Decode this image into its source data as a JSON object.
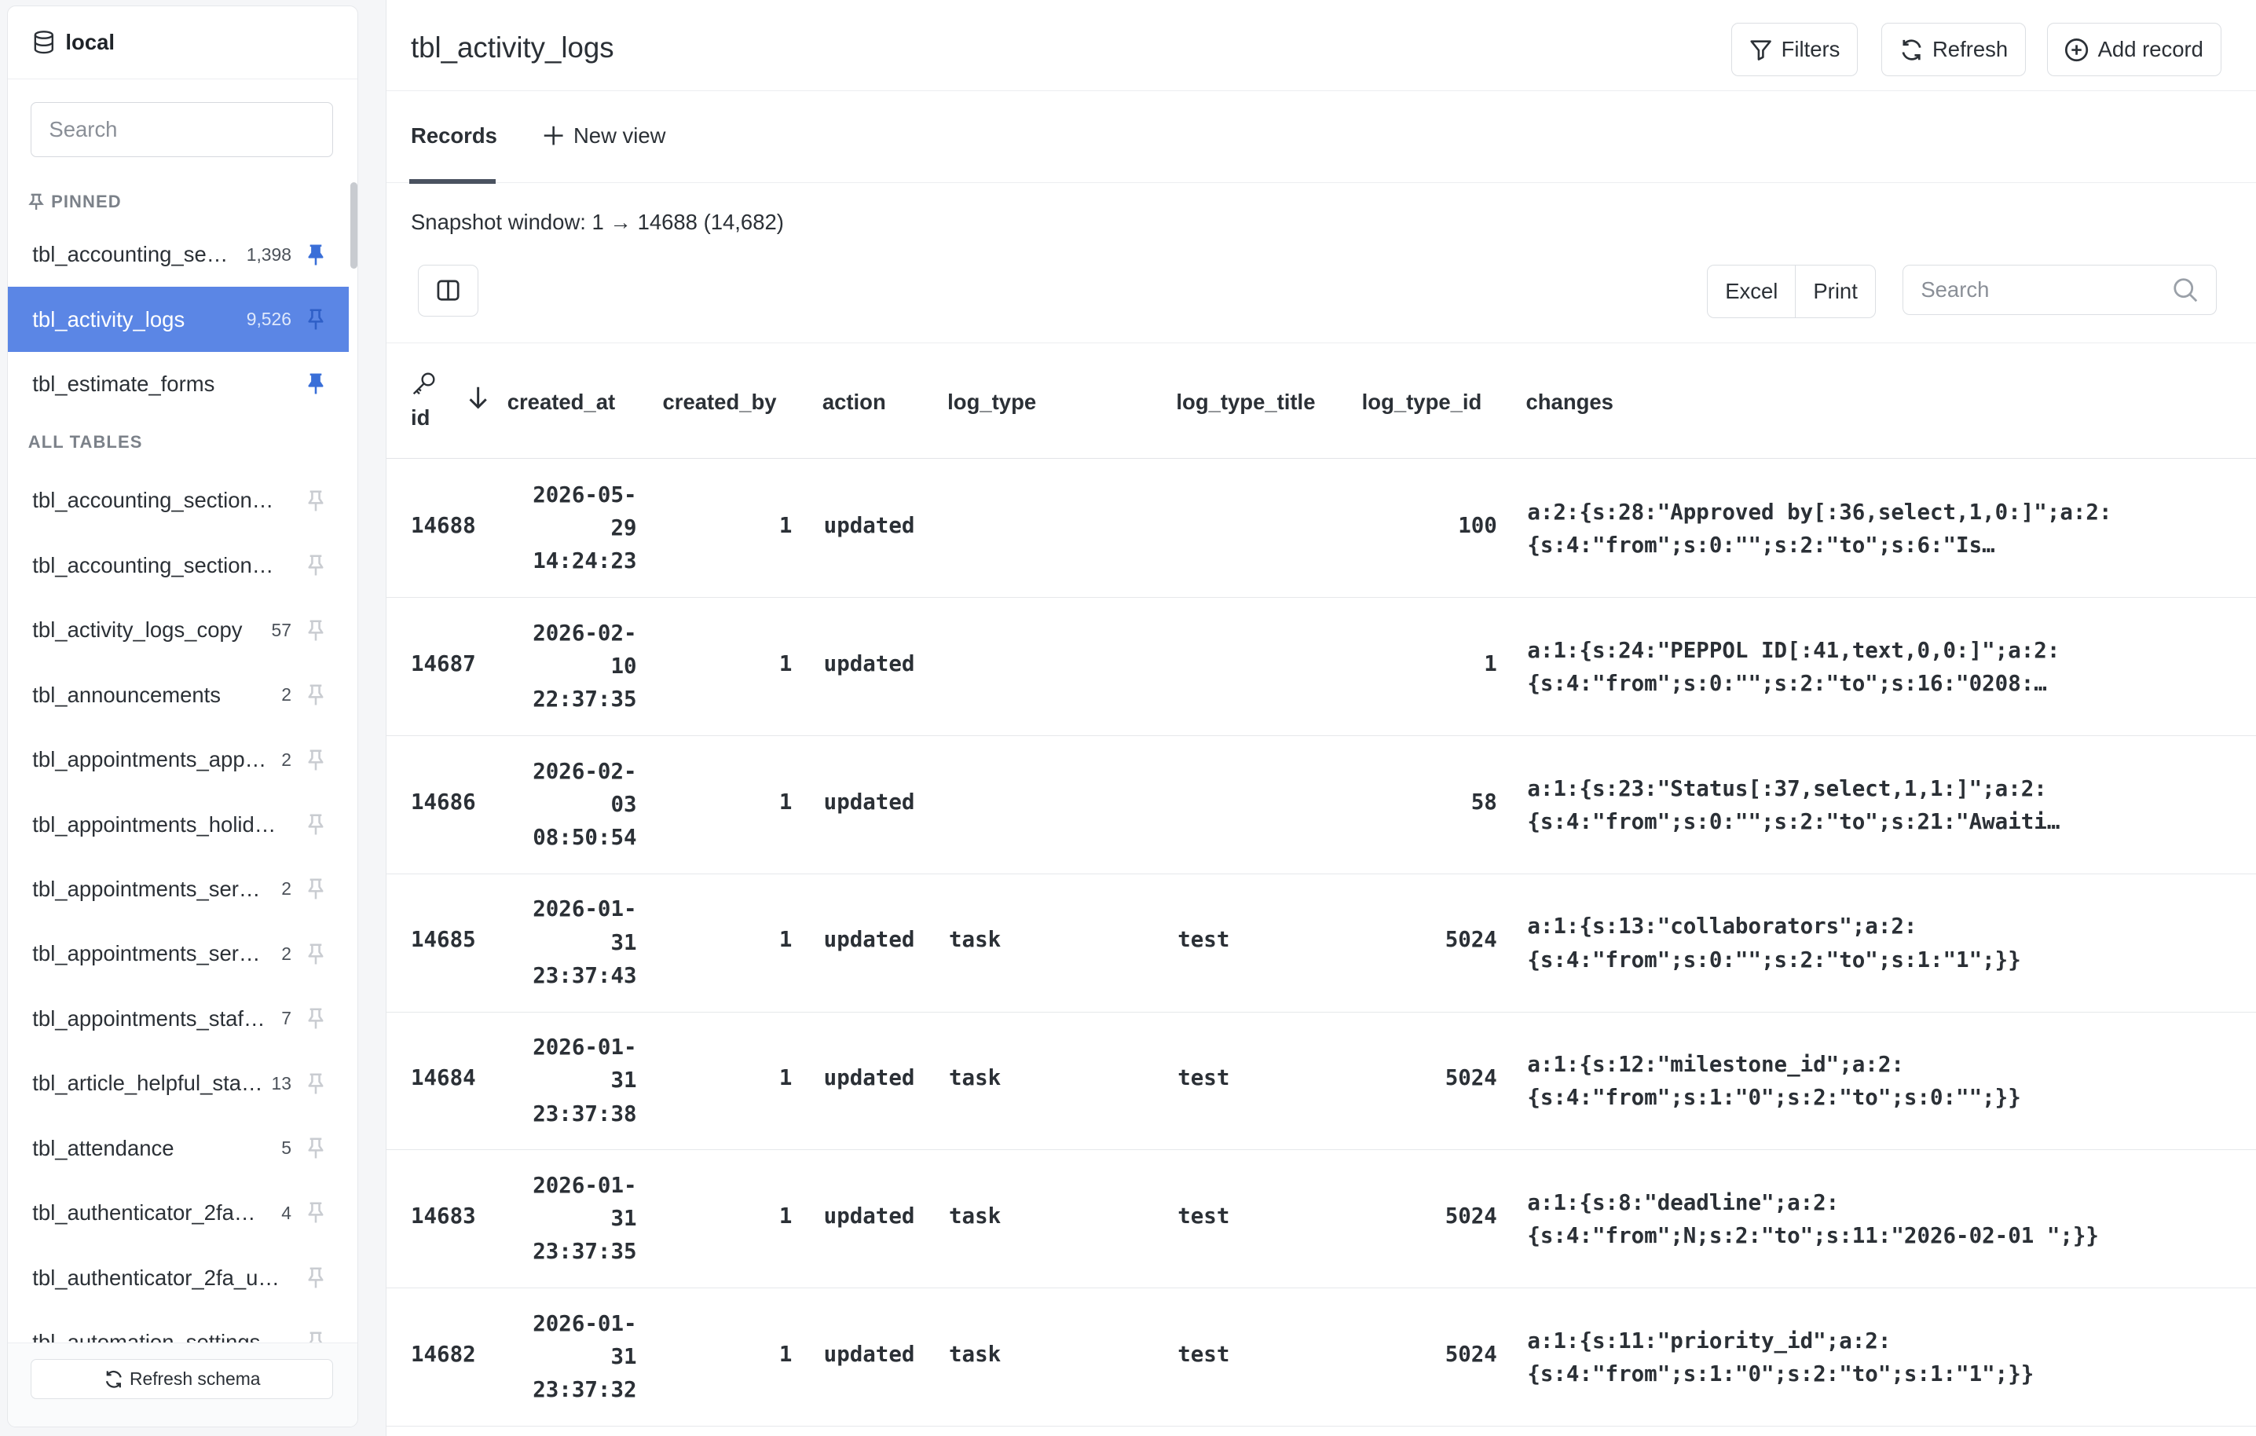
{
  "sidebar": {
    "connection": "local",
    "search_placeholder": "Search",
    "pinned_label": "PINNED",
    "all_tables_label": "ALL TABLES",
    "pinned": [
      {
        "name": "tbl_accounting_se…",
        "count": "1,398"
      },
      {
        "name": "tbl_activity_logs",
        "count": "9,526",
        "active": true
      },
      {
        "name": "tbl_estimate_forms",
        "count": ""
      }
    ],
    "all_tables": [
      {
        "name": "tbl_accounting_sections…",
        "count": ""
      },
      {
        "name": "tbl_accounting_sections…",
        "count": ""
      },
      {
        "name": "tbl_activity_logs_copy",
        "count": "57"
      },
      {
        "name": "tbl_announcements",
        "count": "2"
      },
      {
        "name": "tbl_appointments_app…",
        "count": "2"
      },
      {
        "name": "tbl_appointments_holid…",
        "count": ""
      },
      {
        "name": "tbl_appointments_ser…",
        "count": "2"
      },
      {
        "name": "tbl_appointments_ser…",
        "count": "2"
      },
      {
        "name": "tbl_appointments_staf…",
        "count": "7"
      },
      {
        "name": "tbl_article_helpful_sta…",
        "count": "13"
      },
      {
        "name": "tbl_attendance",
        "count": "5"
      },
      {
        "name": "tbl_authenticator_2fa…",
        "count": "4"
      },
      {
        "name": "tbl_authenticator_2fa_u…",
        "count": ""
      },
      {
        "name": "tbl_automation_settings",
        "count": ""
      }
    ],
    "refresh_schema": "Refresh schema"
  },
  "header": {
    "title": "tbl_activity_logs",
    "filters": "Filters",
    "refresh": "Refresh",
    "add_record": "Add record"
  },
  "tabs": {
    "records": "Records",
    "new_view": "New view"
  },
  "snapshot": "Snapshot window: 1 → 14688 (14,682)",
  "toolbar": {
    "excel": "Excel",
    "print": "Print",
    "search_placeholder": "Search"
  },
  "table": {
    "columns": [
      "id",
      "created_at",
      "created_by",
      "action",
      "log_type",
      "log_type_title",
      "log_type_id",
      "changes"
    ],
    "rows": [
      {
        "id": "14688",
        "created_at": "2026-05-\n29\n14:24:23",
        "created_by": "1",
        "action": "updated",
        "log_type": "",
        "log_type_title": "",
        "log_type_id": "100",
        "changes": "a:2:{s:28:\"Approved by[:36,select,1,0:]\";a:2:\n{s:4:\"from\";s:0:\"\";s:2:\"to\";s:6:\"Is…"
      },
      {
        "id": "14687",
        "created_at": "2026-02-\n10\n22:37:35",
        "created_by": "1",
        "action": "updated",
        "log_type": "",
        "log_type_title": "",
        "log_type_id": "1",
        "changes": "a:1:{s:24:\"PEPPOL ID[:41,text,0,0:]\";a:2:\n{s:4:\"from\";s:0:\"\";s:2:\"to\";s:16:\"0208:…"
      },
      {
        "id": "14686",
        "created_at": "2026-02-\n03\n08:50:54",
        "created_by": "1",
        "action": "updated",
        "log_type": "",
        "log_type_title": "",
        "log_type_id": "58",
        "changes": "a:1:{s:23:\"Status[:37,select,1,1:]\";a:2:\n{s:4:\"from\";s:0:\"\";s:2:\"to\";s:21:\"Awaiti…"
      },
      {
        "id": "14685",
        "created_at": "2026-01-\n31\n23:37:43",
        "created_by": "1",
        "action": "updated",
        "log_type": "task",
        "log_type_title": "test",
        "log_type_id": "5024",
        "changes": "a:1:{s:13:\"collaborators\";a:2:\n{s:4:\"from\";s:0:\"\";s:2:\"to\";s:1:\"1\";}}"
      },
      {
        "id": "14684",
        "created_at": "2026-01-\n31\n23:37:38",
        "created_by": "1",
        "action": "updated",
        "log_type": "task",
        "log_type_title": "test",
        "log_type_id": "5024",
        "changes": "a:1:{s:12:\"milestone_id\";a:2:\n{s:4:\"from\";s:1:\"0\";s:2:\"to\";s:0:\"\";}}"
      },
      {
        "id": "14683",
        "created_at": "2026-01-\n31\n23:37:35",
        "created_by": "1",
        "action": "updated",
        "log_type": "task",
        "log_type_title": "test",
        "log_type_id": "5024",
        "changes": "a:1:{s:8:\"deadline\";a:2:\n{s:4:\"from\";N;s:2:\"to\";s:11:\"2026-02-01 \";}}"
      },
      {
        "id": "14682",
        "created_at": "2026-01-\n31\n23:37:32",
        "created_by": "1",
        "action": "updated",
        "log_type": "task",
        "log_type_title": "test",
        "log_type_id": "5024",
        "changes": "a:1:{s:11:\"priority_id\";a:2:\n{s:4:\"from\";s:1:\"0\";s:2:\"to\";s:1:\"1\";}}"
      }
    ]
  },
  "colors": {
    "accent": "#5b86e5",
    "pin_active": "#3a6fd8",
    "pin_inactive": "#c9ccd1"
  }
}
